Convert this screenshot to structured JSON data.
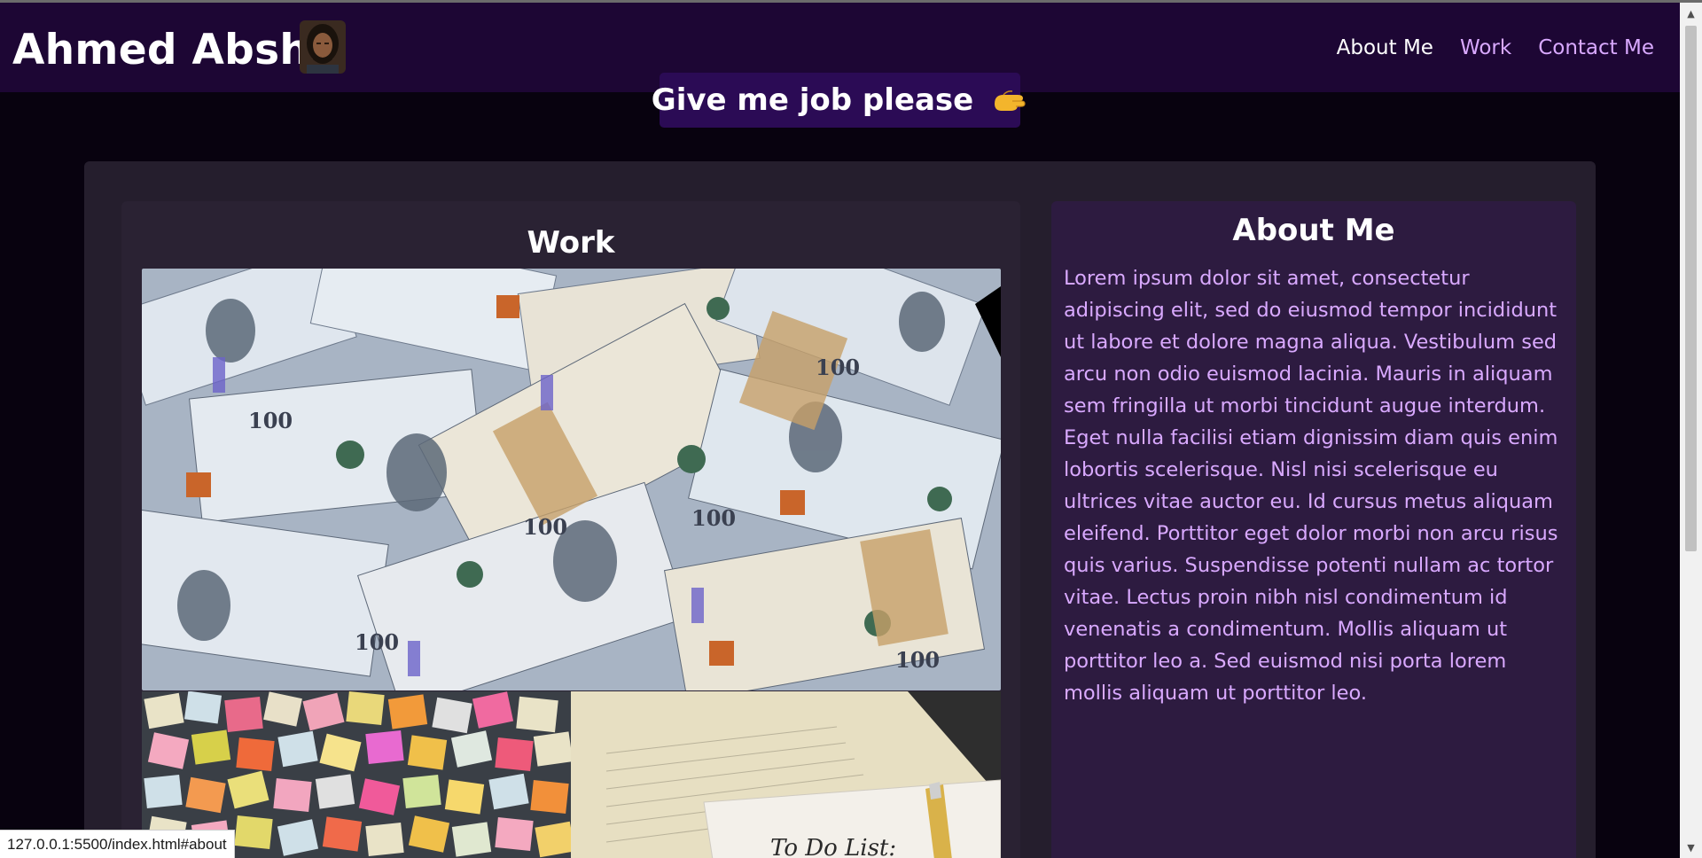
{
  "header": {
    "site_title": "Ahmed Abshir",
    "nav": [
      {
        "label": "About Me",
        "active": true
      },
      {
        "label": "Work",
        "active": false
      },
      {
        "label": "Contact Me",
        "active": false
      }
    ]
  },
  "hire_button": {
    "label": "Give me job please",
    "icon": "hand-icon"
  },
  "work": {
    "title": "Work",
    "images": [
      "hundred-dollar-bills",
      "sticky-notes-wall",
      "to-do-list-calendar"
    ],
    "todo_caption": "To Do List:"
  },
  "about": {
    "title": "About Me",
    "text": "Lorem ipsum dolor sit amet, consectetur adipiscing elit, sed do eiusmod tempor incididunt ut labore et dolore magna aliqua. Vestibulum sed arcu non odio euismod lacinia. Mauris in aliquam sem fringilla ut morbi tincidunt augue interdum. Eget nulla facilisi etiam dignissim diam quis enim lobortis scelerisque. Nisl nisi scelerisque eu ultrices vitae auctor eu. Id cursus metus aliquam eleifend. Porttitor eget dolor morbi non arcu risus quis varius. Suspendisse potenti nullam ac tortor vitae. Lectus proin nibh nisl condimentum id venenatis a condimentum. Mollis aliquam ut porttitor leo a. Sed euismod nisi porta lorem mollis aliquam ut porttitor leo."
  },
  "status_bar": {
    "url": "127.0.0.1:5500/index.html#about"
  },
  "colors": {
    "header_bg": "#1d0634",
    "page_bg": "#08020f",
    "nav_link": "#d9a9ff",
    "about_text": "#d9a9ff",
    "button_bg": "#2b0b55"
  }
}
